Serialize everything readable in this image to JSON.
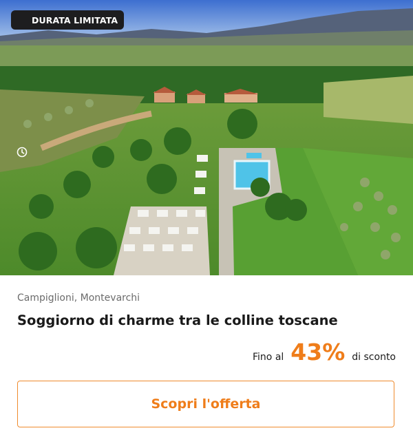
{
  "badge": {
    "label": "DURATA LIMITATA",
    "icon": "clock-icon"
  },
  "offer": {
    "location": "Campiglioni, Montevarchi",
    "title": "Soggiorno di charme tra le colline toscane",
    "discount_prefix": "Fino al",
    "discount_value": "43%",
    "discount_suffix": "di sconto",
    "cta_label": "Scopri l'offerta"
  },
  "colors": {
    "accent": "#ef7d1a",
    "badge_bg": "#1d1d1f",
    "text": "#1a1a1a",
    "muted": "#6b6b6b"
  }
}
